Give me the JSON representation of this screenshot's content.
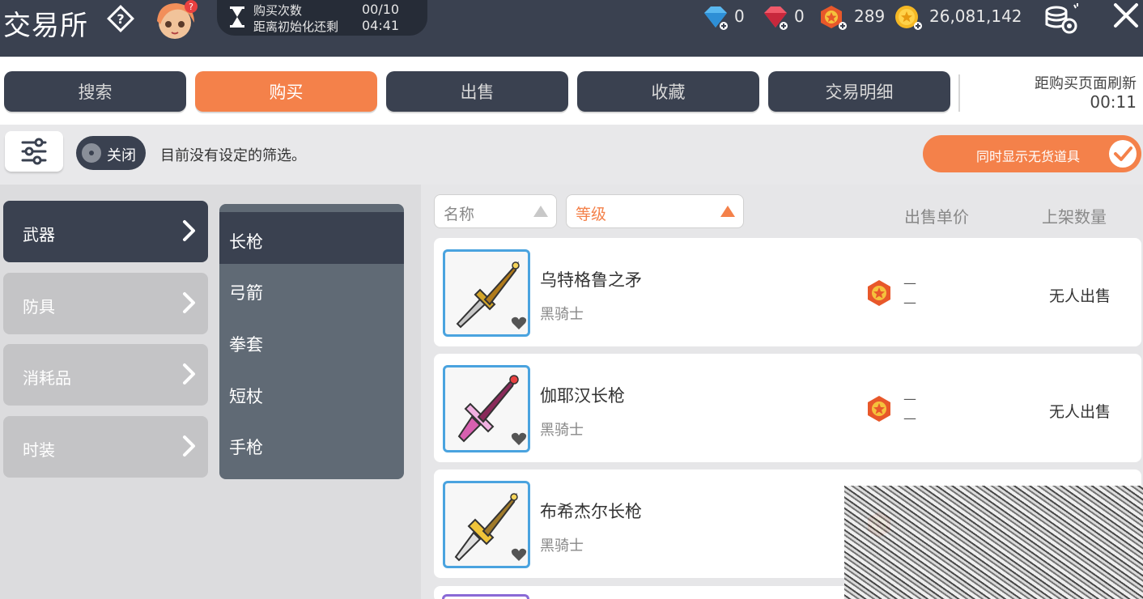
{
  "header": {
    "title": "交易所",
    "purchase_count_label": "购买次数",
    "purchase_count_value": "00/10",
    "reset_label": "距离初始化还剩",
    "reset_value": "04:41",
    "currencies": {
      "blue_diamond": "0",
      "red_gem": "0",
      "star_medal": "289",
      "gold_coin": "26,081,142"
    }
  },
  "tabs": [
    {
      "label": "搜索"
    },
    {
      "label": "购买"
    },
    {
      "label": "出售"
    },
    {
      "label": "收藏"
    },
    {
      "label": "交易明细"
    }
  ],
  "refresh": {
    "label": "距购买页面刷新",
    "value": "00:11"
  },
  "filter": {
    "toggle_label": "关闭",
    "status_text": "目前没有设定的筛选。",
    "show_all_label": "同时显示无货道具"
  },
  "categories": [
    {
      "label": "武器"
    },
    {
      "label": "防具"
    },
    {
      "label": "消耗品"
    },
    {
      "label": "时装"
    }
  ],
  "subcategories": [
    {
      "label": "长枪"
    },
    {
      "label": "弓箭"
    },
    {
      "label": "拳套"
    },
    {
      "label": "短杖"
    },
    {
      "label": "手枪"
    }
  ],
  "list": {
    "sort_name": "名称",
    "sort_level": "等级",
    "col_price": "出售单价",
    "col_qty": "上架数量",
    "items": [
      {
        "name": "乌特格鲁之矛",
        "class": "黑骑士",
        "price_dash": "—",
        "status": "无人出售"
      },
      {
        "name": "伽耶汉长枪",
        "class": "黑骑士",
        "price_dash": "—",
        "status": "无人出售"
      },
      {
        "name": "布希杰尔长枪",
        "class": "黑骑士",
        "price_dash": "—",
        "status": ""
      }
    ]
  },
  "colors": {
    "accent": "#f4814a",
    "dark": "#3a4150",
    "frame_blue": "#4aa3df"
  }
}
